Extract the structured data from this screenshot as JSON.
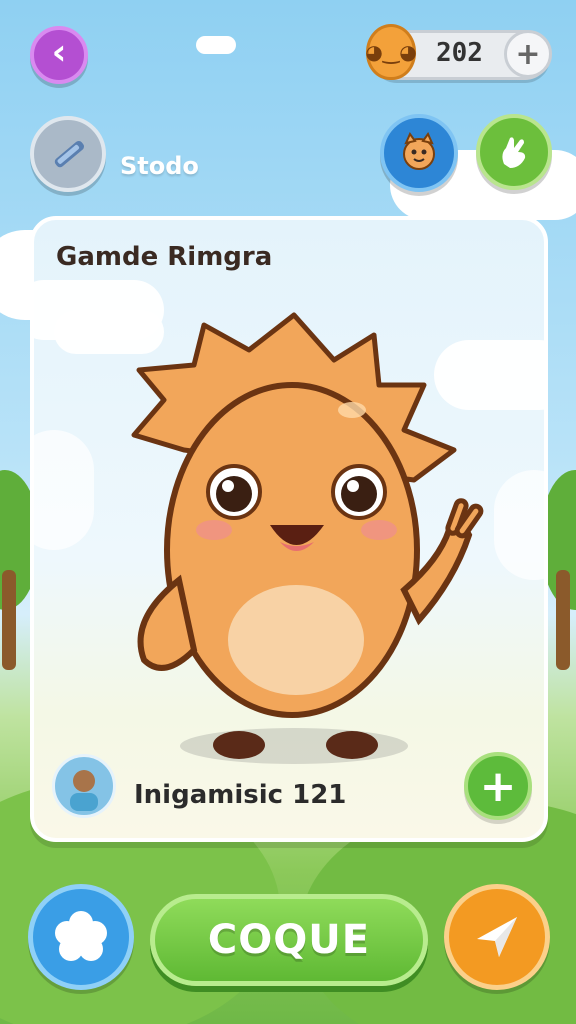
{
  "top_bar": {
    "back_icon": "chevron-left-icon",
    "coin_value": "202",
    "coin_icon": "coin-face-icon",
    "add_coins_icon": "plus-icon"
  },
  "secondary_bar": {
    "tool_icon": "pen-icon",
    "tool_label": "Stodo",
    "pet_icon": "pet-face-icon",
    "hand_icon": "hand-icon"
  },
  "card": {
    "title": "Gamde Rimgra",
    "footer_text": "Inigamisic 121",
    "avatar_icon": "avatar-icon",
    "add_icon": "plus-icon"
  },
  "bottom_bar": {
    "main_button_label": "COQUE",
    "left_icon": "flower-icon",
    "right_icon": "send-icon"
  },
  "colors": {
    "back_button": "#b44fd2",
    "main_button": "#5fb934",
    "left_button": "#3a9ee6",
    "right_button": "#f39a22",
    "creature": "#f2a65a"
  }
}
